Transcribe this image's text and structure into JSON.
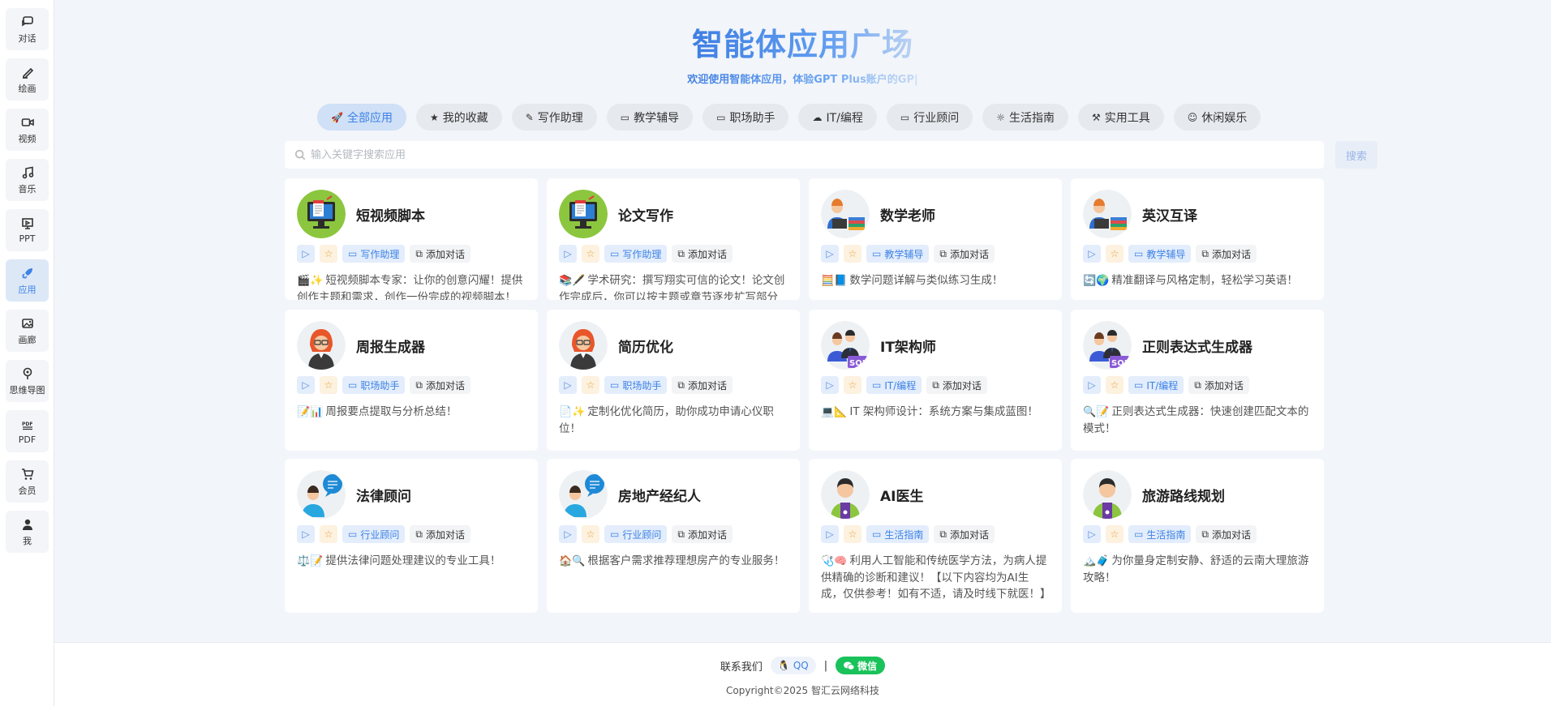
{
  "sidebar": {
    "items": [
      {
        "label": "对话",
        "icon": "chat-icon"
      },
      {
        "label": "绘画",
        "icon": "brush-icon"
      },
      {
        "label": "视频",
        "icon": "video-icon"
      },
      {
        "label": "音乐",
        "icon": "music-icon"
      },
      {
        "label": "PPT",
        "icon": "presentation-icon"
      },
      {
        "label": "应用",
        "icon": "rocket-icon",
        "active": true
      },
      {
        "label": "画廊",
        "icon": "gallery-icon"
      },
      {
        "label": "思维导图",
        "icon": "mindmap-icon"
      },
      {
        "label": "PDF",
        "icon": "pdf-icon"
      },
      {
        "label": "会员",
        "icon": "cart-icon"
      },
      {
        "label": "我",
        "icon": "user-icon"
      }
    ]
  },
  "header": {
    "title": "智能体应用广场",
    "subtitle": "欢迎使用智能体应用，体验GPT Plus账户的GP|"
  },
  "tabs": [
    {
      "label": "全部应用",
      "icon": "rocket-icon",
      "active": true
    },
    {
      "label": "我的收藏",
      "icon": "star-icon"
    },
    {
      "label": "写作助理",
      "icon": "edit-icon"
    },
    {
      "label": "教学辅导",
      "icon": "teach-icon"
    },
    {
      "label": "职场助手",
      "icon": "laptop-icon"
    },
    {
      "label": "IT/编程",
      "icon": "cloud-icon"
    },
    {
      "label": "行业顾问",
      "icon": "consult-icon"
    },
    {
      "label": "生活指南",
      "icon": "sun-icon"
    },
    {
      "label": "实用工具",
      "icon": "tool-icon"
    },
    {
      "label": "休闲娱乐",
      "icon": "smile-icon"
    }
  ],
  "search": {
    "placeholder": "输入关键字搜索应用",
    "button": "搜索"
  },
  "cards": [
    {
      "title": "短视频脚本",
      "avatar": "monitor",
      "tag": "写作助理",
      "add": "添加对话",
      "emoji": "🎬✨",
      "desc": "短视频脚本专家：让你的创意闪耀！提供创作主题和需求，创作一份完成的视频脚本！"
    },
    {
      "title": "论文写作",
      "avatar": "monitor",
      "tag": "写作助理",
      "add": "添加对话",
      "emoji": "📚🖋️",
      "desc": "学术研究：撰写翔实可信的论文！论文创作完成后，你可以按主题或章节逐步扩写部分内容！"
    },
    {
      "title": "数学老师",
      "avatar": "teacher",
      "tag": "教学辅导",
      "add": "添加对话",
      "emoji": "🧮📘",
      "desc": "数学问题详解与类似练习生成！"
    },
    {
      "title": "英汉互译",
      "avatar": "teacher",
      "tag": "教学辅导",
      "add": "添加对话",
      "emoji": "🔄🌍",
      "desc": "精准翻译与风格定制，轻松学习英语！"
    },
    {
      "title": "周报生成器",
      "avatar": "redhair",
      "tag": "职场助手",
      "add": "添加对话",
      "emoji": "📝📊",
      "desc": "周报要点提取与分析总结！"
    },
    {
      "title": "简历优化",
      "avatar": "redhair",
      "tag": "职场助手",
      "add": "添加对话",
      "emoji": "📄✨",
      "desc": "定制化优化简历，助你成功申请心仪职位！"
    },
    {
      "title": "IT架构师",
      "avatar": "sql",
      "tag": "IT/编程",
      "add": "添加对话",
      "emoji": "💻📐",
      "desc": "IT 架构师设计：系统方案与集成蓝图！"
    },
    {
      "title": "正则表达式生成器",
      "avatar": "sql",
      "tag": "IT/编程",
      "add": "添加对话",
      "emoji": "🔍📝",
      "desc": "正则表达式生成器：快速创建匹配文本的模式！"
    },
    {
      "title": "法律顾问",
      "avatar": "bubble",
      "tag": "行业顾问",
      "add": "添加对话",
      "emoji": "⚖️📝",
      "desc": "提供法律问题处理建议的专业工具！"
    },
    {
      "title": "房地产经纪人",
      "avatar": "bubble",
      "tag": "行业顾问",
      "add": "添加对话",
      "emoji": "🏠🔍",
      "desc": "根据客户需求推荐理想房产的专业服务！"
    },
    {
      "title": "AI医生",
      "avatar": "doctor",
      "tag": "生活指南",
      "add": "添加对话",
      "emoji": "🩺🧠",
      "desc": "利用人工智能和传统医学方法，为病人提供精确的诊断和建议！【以下内容均为AI生成，仅供参考！如有不适，请及时线下就医！】"
    },
    {
      "title": "旅游路线规划",
      "avatar": "doctor",
      "tag": "生活指南",
      "add": "添加对话",
      "emoji": "🏔️🧳",
      "desc": "为你量身定制安静、舒适的云南大理旅游攻略！"
    }
  ],
  "footer": {
    "contact_label": "联系我们",
    "qq": "QQ",
    "divider": "|",
    "wechat": "微信",
    "copyright": "Copyright©2025 智汇云网络科技"
  }
}
